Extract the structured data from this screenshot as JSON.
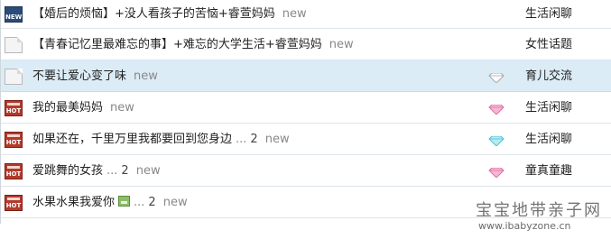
{
  "threads": [
    {
      "icon": "new-thread-icon",
      "icon_text": "NEW",
      "title": "【婚后的烦恼】+没人看孩子的苦恼+睿萱妈妈",
      "new_tag": "new",
      "forum": "生活闲聊"
    },
    {
      "icon": "document-icon",
      "title": "【青春记忆里最难忘的事】+难忘的大学生活+睿萱妈妈",
      "new_tag": "new",
      "forum": "女性话题"
    },
    {
      "icon": "document-icon",
      "title": "不要让爱心变了味",
      "new_tag": "new",
      "forum": "育儿交流",
      "gem": "gray"
    },
    {
      "icon": "hot-thread-icon",
      "icon_text": "HOT",
      "title": "我的最美妈妈",
      "new_tag": "new",
      "forum": "生活闲聊",
      "gem": "pink"
    },
    {
      "icon": "hot-thread-icon",
      "icon_text": "HOT",
      "title": "如果还在，千里万里我都要回到您身边",
      "ellipsis": "...",
      "page": "2",
      "new_tag": "new",
      "forum": "生活闲聊",
      "gem": "cyan"
    },
    {
      "icon": "hot-thread-icon",
      "icon_text": "HOT",
      "title": "爱跳舞的女孩",
      "ellipsis": "...",
      "page": "2",
      "new_tag": "new",
      "forum": "童真童趣",
      "gem": "pink"
    },
    {
      "icon": "hot-thread-icon",
      "icon_text": "HOT",
      "title": "水果水果我爱你",
      "has_image_icon": true,
      "ellipsis": "...",
      "page": "2",
      "new_tag": "new",
      "forum": ""
    }
  ],
  "gem_colors": {
    "gray": "#c8c8c8",
    "pink": "#f39ac2",
    "cyan": "#7fd6e6"
  },
  "watermark": {
    "name": "宝宝地带亲子网",
    "url": "www.ibabyzone.cn"
  }
}
